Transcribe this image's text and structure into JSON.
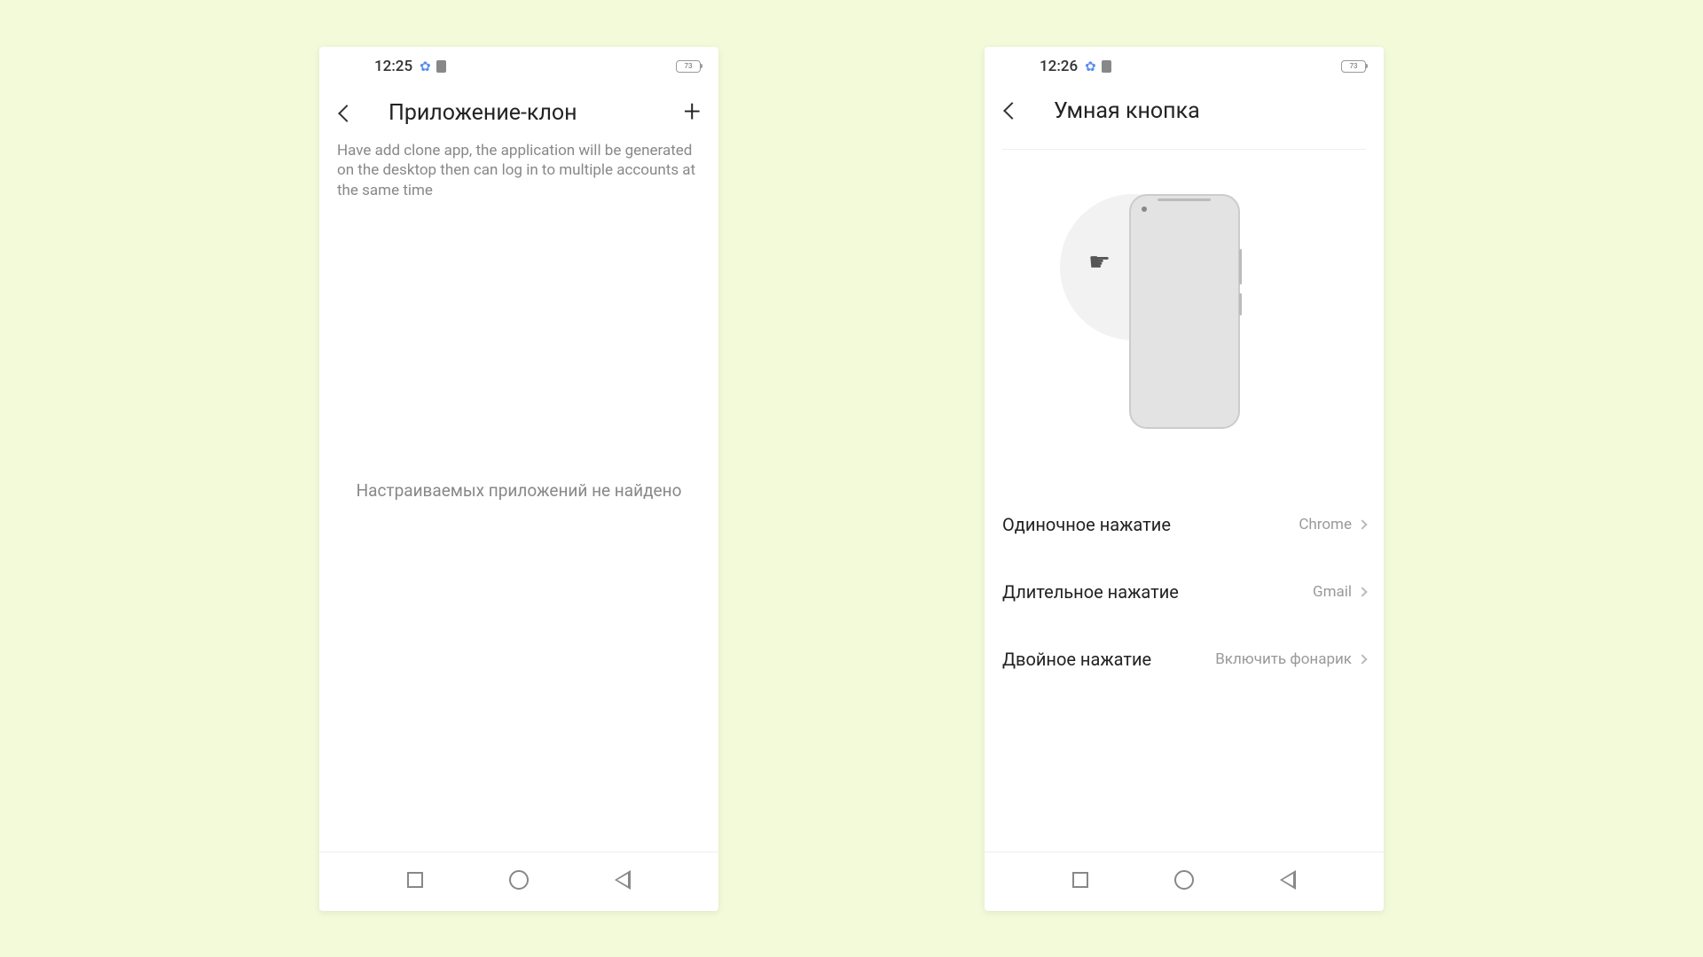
{
  "phone1": {
    "status": {
      "time": "12:25",
      "battery": "73"
    },
    "header": {
      "title": "Приложение-клон",
      "add": "+"
    },
    "description": "Have add clone app, the application will be generated on the desktop then can log in to multiple accounts at the same time",
    "empty": "Настраиваемых приложений не найдено"
  },
  "phone2": {
    "status": {
      "time": "12:26",
      "battery": "73"
    },
    "header": {
      "title": "Умная кнопка"
    },
    "settings": [
      {
        "label": "Одиночное нажатие",
        "value": "Chrome"
      },
      {
        "label": "Длительное нажатие",
        "value": "Gmail"
      },
      {
        "label": "Двойное нажатие",
        "value": "Включить фонарик"
      }
    ]
  }
}
